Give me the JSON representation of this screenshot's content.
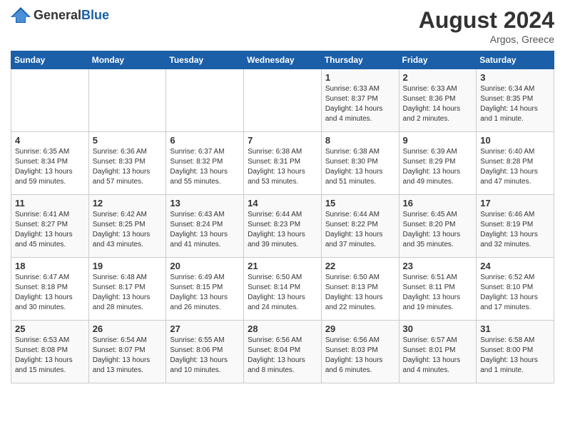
{
  "header": {
    "logo_general": "General",
    "logo_blue": "Blue",
    "month_year": "August 2024",
    "location": "Argos, Greece"
  },
  "weekdays": [
    "Sunday",
    "Monday",
    "Tuesday",
    "Wednesday",
    "Thursday",
    "Friday",
    "Saturday"
  ],
  "weeks": [
    [
      {
        "day": "",
        "sunrise": "",
        "sunset": "",
        "daylight": ""
      },
      {
        "day": "",
        "sunrise": "",
        "sunset": "",
        "daylight": ""
      },
      {
        "day": "",
        "sunrise": "",
        "sunset": "",
        "daylight": ""
      },
      {
        "day": "",
        "sunrise": "",
        "sunset": "",
        "daylight": ""
      },
      {
        "day": "1",
        "sunrise": "Sunrise: 6:33 AM",
        "sunset": "Sunset: 8:37 PM",
        "daylight": "Daylight: 14 hours and 4 minutes."
      },
      {
        "day": "2",
        "sunrise": "Sunrise: 6:33 AM",
        "sunset": "Sunset: 8:36 PM",
        "daylight": "Daylight: 14 hours and 2 minutes."
      },
      {
        "day": "3",
        "sunrise": "Sunrise: 6:34 AM",
        "sunset": "Sunset: 8:35 PM",
        "daylight": "Daylight: 14 hours and 1 minute."
      }
    ],
    [
      {
        "day": "4",
        "sunrise": "Sunrise: 6:35 AM",
        "sunset": "Sunset: 8:34 PM",
        "daylight": "Daylight: 13 hours and 59 minutes."
      },
      {
        "day": "5",
        "sunrise": "Sunrise: 6:36 AM",
        "sunset": "Sunset: 8:33 PM",
        "daylight": "Daylight: 13 hours and 57 minutes."
      },
      {
        "day": "6",
        "sunrise": "Sunrise: 6:37 AM",
        "sunset": "Sunset: 8:32 PM",
        "daylight": "Daylight: 13 hours and 55 minutes."
      },
      {
        "day": "7",
        "sunrise": "Sunrise: 6:38 AM",
        "sunset": "Sunset: 8:31 PM",
        "daylight": "Daylight: 13 hours and 53 minutes."
      },
      {
        "day": "8",
        "sunrise": "Sunrise: 6:38 AM",
        "sunset": "Sunset: 8:30 PM",
        "daylight": "Daylight: 13 hours and 51 minutes."
      },
      {
        "day": "9",
        "sunrise": "Sunrise: 6:39 AM",
        "sunset": "Sunset: 8:29 PM",
        "daylight": "Daylight: 13 hours and 49 minutes."
      },
      {
        "day": "10",
        "sunrise": "Sunrise: 6:40 AM",
        "sunset": "Sunset: 8:28 PM",
        "daylight": "Daylight: 13 hours and 47 minutes."
      }
    ],
    [
      {
        "day": "11",
        "sunrise": "Sunrise: 6:41 AM",
        "sunset": "Sunset: 8:27 PM",
        "daylight": "Daylight: 13 hours and 45 minutes."
      },
      {
        "day": "12",
        "sunrise": "Sunrise: 6:42 AM",
        "sunset": "Sunset: 8:25 PM",
        "daylight": "Daylight: 13 hours and 43 minutes."
      },
      {
        "day": "13",
        "sunrise": "Sunrise: 6:43 AM",
        "sunset": "Sunset: 8:24 PM",
        "daylight": "Daylight: 13 hours and 41 minutes."
      },
      {
        "day": "14",
        "sunrise": "Sunrise: 6:44 AM",
        "sunset": "Sunset: 8:23 PM",
        "daylight": "Daylight: 13 hours and 39 minutes."
      },
      {
        "day": "15",
        "sunrise": "Sunrise: 6:44 AM",
        "sunset": "Sunset: 8:22 PM",
        "daylight": "Daylight: 13 hours and 37 minutes."
      },
      {
        "day": "16",
        "sunrise": "Sunrise: 6:45 AM",
        "sunset": "Sunset: 8:20 PM",
        "daylight": "Daylight: 13 hours and 35 minutes."
      },
      {
        "day": "17",
        "sunrise": "Sunrise: 6:46 AM",
        "sunset": "Sunset: 8:19 PM",
        "daylight": "Daylight: 13 hours and 32 minutes."
      }
    ],
    [
      {
        "day": "18",
        "sunrise": "Sunrise: 6:47 AM",
        "sunset": "Sunset: 8:18 PM",
        "daylight": "Daylight: 13 hours and 30 minutes."
      },
      {
        "day": "19",
        "sunrise": "Sunrise: 6:48 AM",
        "sunset": "Sunset: 8:17 PM",
        "daylight": "Daylight: 13 hours and 28 minutes."
      },
      {
        "day": "20",
        "sunrise": "Sunrise: 6:49 AM",
        "sunset": "Sunset: 8:15 PM",
        "daylight": "Daylight: 13 hours and 26 minutes."
      },
      {
        "day": "21",
        "sunrise": "Sunrise: 6:50 AM",
        "sunset": "Sunset: 8:14 PM",
        "daylight": "Daylight: 13 hours and 24 minutes."
      },
      {
        "day": "22",
        "sunrise": "Sunrise: 6:50 AM",
        "sunset": "Sunset: 8:13 PM",
        "daylight": "Daylight: 13 hours and 22 minutes."
      },
      {
        "day": "23",
        "sunrise": "Sunrise: 6:51 AM",
        "sunset": "Sunset: 8:11 PM",
        "daylight": "Daylight: 13 hours and 19 minutes."
      },
      {
        "day": "24",
        "sunrise": "Sunrise: 6:52 AM",
        "sunset": "Sunset: 8:10 PM",
        "daylight": "Daylight: 13 hours and 17 minutes."
      }
    ],
    [
      {
        "day": "25",
        "sunrise": "Sunrise: 6:53 AM",
        "sunset": "Sunset: 8:08 PM",
        "daylight": "Daylight: 13 hours and 15 minutes."
      },
      {
        "day": "26",
        "sunrise": "Sunrise: 6:54 AM",
        "sunset": "Sunset: 8:07 PM",
        "daylight": "Daylight: 13 hours and 13 minutes."
      },
      {
        "day": "27",
        "sunrise": "Sunrise: 6:55 AM",
        "sunset": "Sunset: 8:06 PM",
        "daylight": "Daylight: 13 hours and 10 minutes."
      },
      {
        "day": "28",
        "sunrise": "Sunrise: 6:56 AM",
        "sunset": "Sunset: 8:04 PM",
        "daylight": "Daylight: 13 hours and 8 minutes."
      },
      {
        "day": "29",
        "sunrise": "Sunrise: 6:56 AM",
        "sunset": "Sunset: 8:03 PM",
        "daylight": "Daylight: 13 hours and 6 minutes."
      },
      {
        "day": "30",
        "sunrise": "Sunrise: 6:57 AM",
        "sunset": "Sunset: 8:01 PM",
        "daylight": "Daylight: 13 hours and 4 minutes."
      },
      {
        "day": "31",
        "sunrise": "Sunrise: 6:58 AM",
        "sunset": "Sunset: 8:00 PM",
        "daylight": "Daylight: 13 hours and 1 minute."
      }
    ]
  ]
}
